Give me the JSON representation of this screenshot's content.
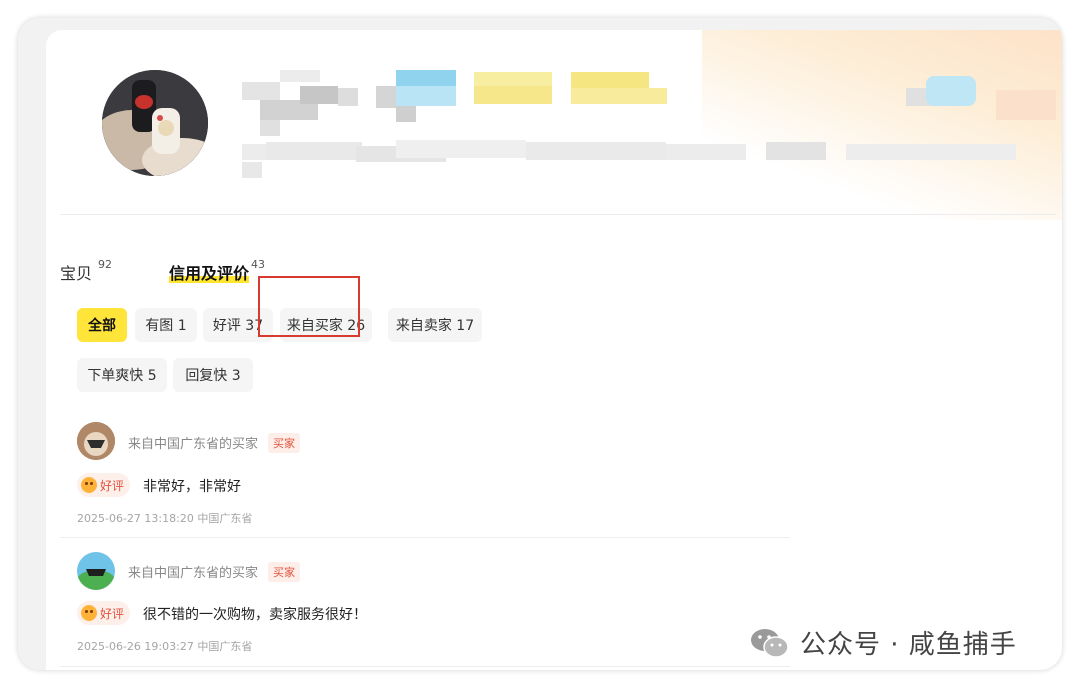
{
  "tabs": [
    {
      "label": "宝贝",
      "count": "92"
    },
    {
      "label": "信用及评价",
      "count": "43"
    }
  ],
  "filters": [
    {
      "label": "全部"
    },
    {
      "label": "有图 1"
    },
    {
      "label": "好评 37"
    },
    {
      "label": "来自买家 26"
    },
    {
      "label": "来自卖家 17"
    },
    {
      "label": "下单爽快 5"
    },
    {
      "label": "回复快 3"
    }
  ],
  "reviews": [
    {
      "from": "来自中国广东省的买家",
      "badge": "买家",
      "rating": "好评",
      "text": "非常好，非常好",
      "time": "2025-06-27 13:18:20 中国广东省"
    },
    {
      "from": "来自中国广东省的买家",
      "badge": "买家",
      "rating": "好评",
      "text": "很不错的一次购物，卖家服务很好！",
      "time": "2025-06-26 19:03:27 中国广东省"
    }
  ],
  "watermark": {
    "text": "公众号 · 咸鱼捕手"
  },
  "colors": {
    "accent": "#ffe43a",
    "highlight_box": "#d93a2f",
    "badge": "#e1533b"
  }
}
